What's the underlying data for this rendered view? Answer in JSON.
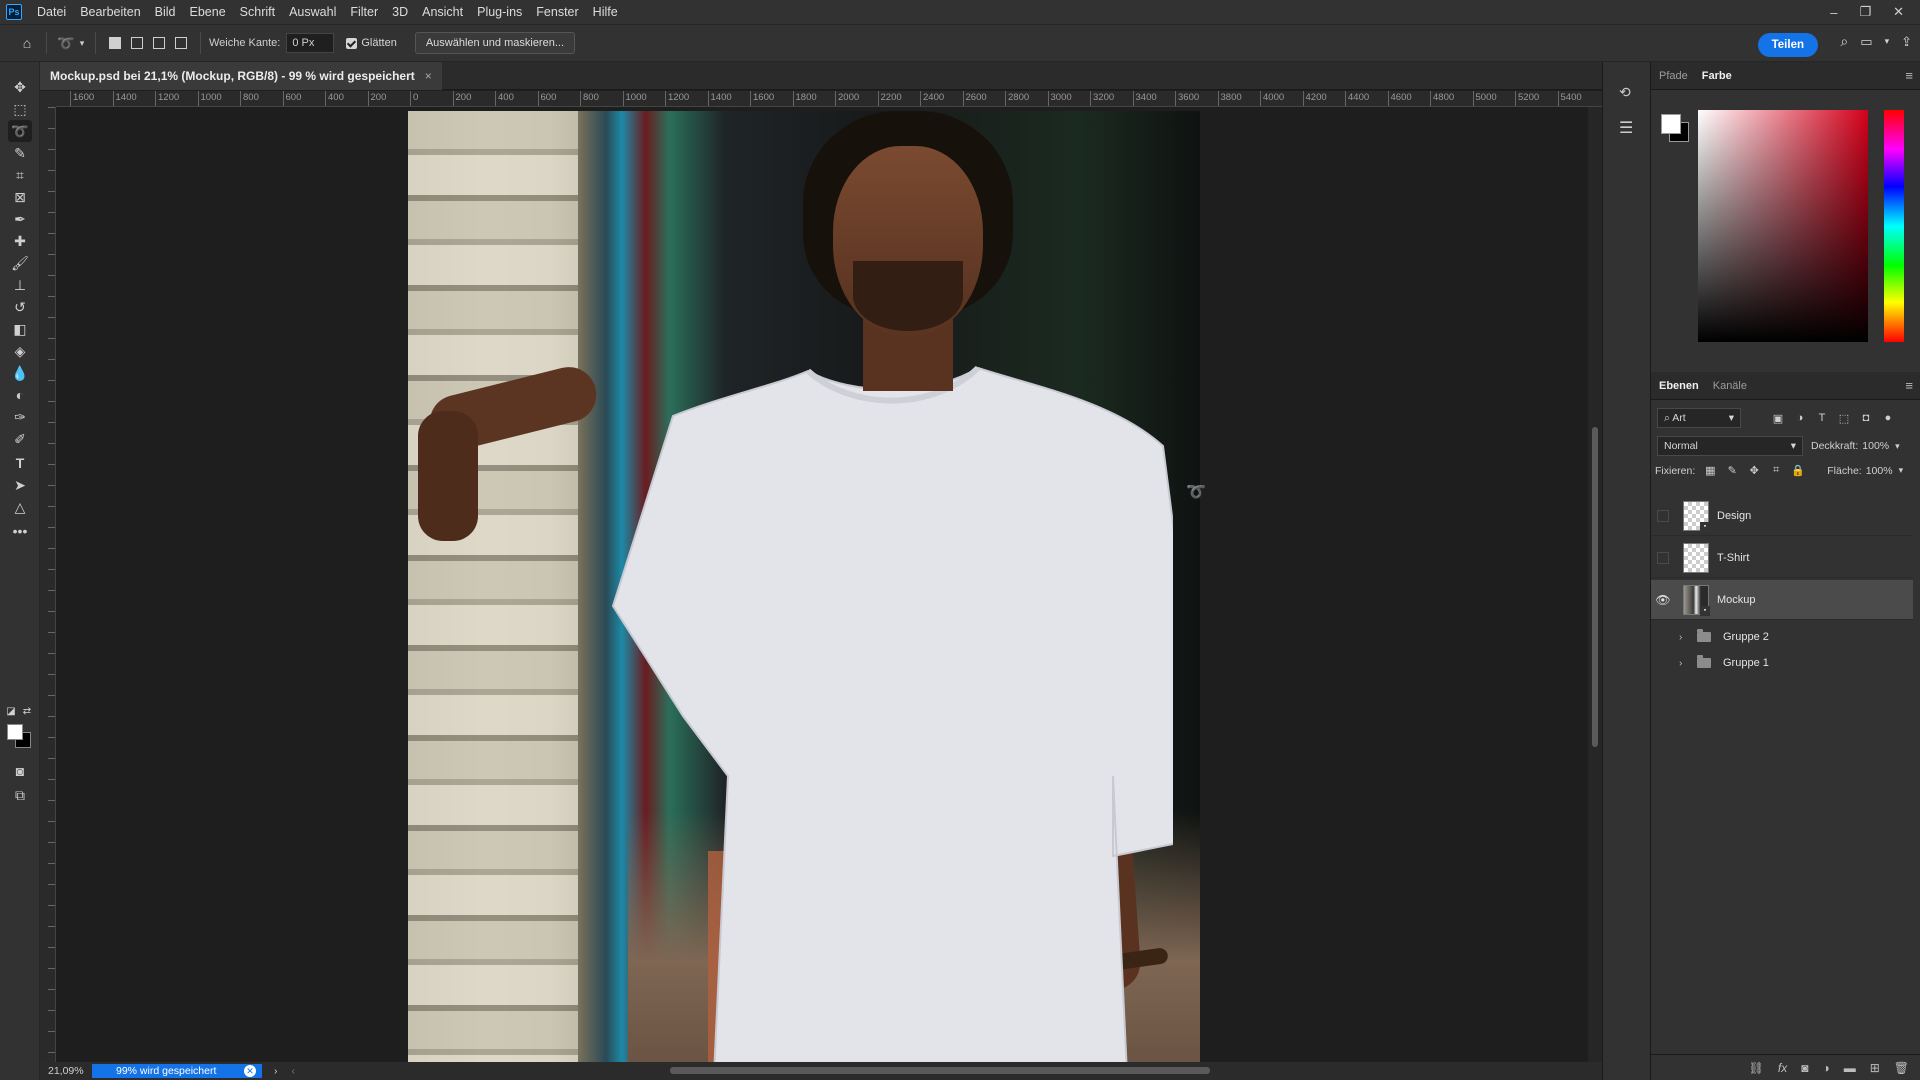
{
  "menu": {
    "app_logo": "Ps",
    "items": [
      "Datei",
      "Bearbeiten",
      "Bild",
      "Ebene",
      "Schrift",
      "Auswahl",
      "Filter",
      "3D",
      "Ansicht",
      "Plug-ins",
      "Fenster",
      "Hilfe"
    ]
  },
  "options": {
    "feather_label": "Weiche Kante:",
    "feather_value": "0 Px",
    "antialias_label": "Glätten",
    "select_mask_label": "Auswählen und maskieren...",
    "share_label": "Teilen"
  },
  "document": {
    "tab_title": "Mockup.psd bei 21,1% (Mockup, RGB/8) - 99 % wird gespeichert",
    "ruler_ticks": [
      "1600",
      "1400",
      "1200",
      "1000",
      "800",
      "600",
      "400",
      "200",
      "0",
      "200",
      "400",
      "600",
      "800",
      "1000",
      "1200",
      "1400",
      "1600",
      "1800",
      "2000",
      "2200",
      "2400",
      "2600",
      "2800",
      "3000",
      "3200",
      "3400",
      "3600",
      "3800",
      "4000",
      "4200",
      "4400",
      "4600",
      "4800",
      "5000",
      "5200",
      "5400"
    ]
  },
  "panels": {
    "color_tabs": [
      "Pfade",
      "Farbe"
    ],
    "color_active": "Farbe",
    "layers_tabs": [
      "Ebenen",
      "Kanäle"
    ],
    "layers_active": "Ebenen",
    "filter_kind": "Art",
    "blend_mode": "Normal",
    "opacity_label": "Deckkraft:",
    "opacity_value": "100%",
    "lock_label": "Fixieren:",
    "fill_label": "Fläche:",
    "fill_value": "100%",
    "layers": [
      {
        "name": "Design",
        "visible": false,
        "selected": false
      },
      {
        "name": "T-Shirt",
        "visible": false,
        "selected": false
      },
      {
        "name": "Mockup",
        "visible": true,
        "selected": true
      }
    ],
    "groups": [
      {
        "name": "Gruppe 2"
      },
      {
        "name": "Gruppe 1"
      }
    ]
  },
  "status": {
    "zoom": "21,09%",
    "save_progress": "99% wird gespeichert"
  },
  "colors": {
    "accent": "#1473e6",
    "foreground": "#ffffff",
    "background": "#000000"
  }
}
